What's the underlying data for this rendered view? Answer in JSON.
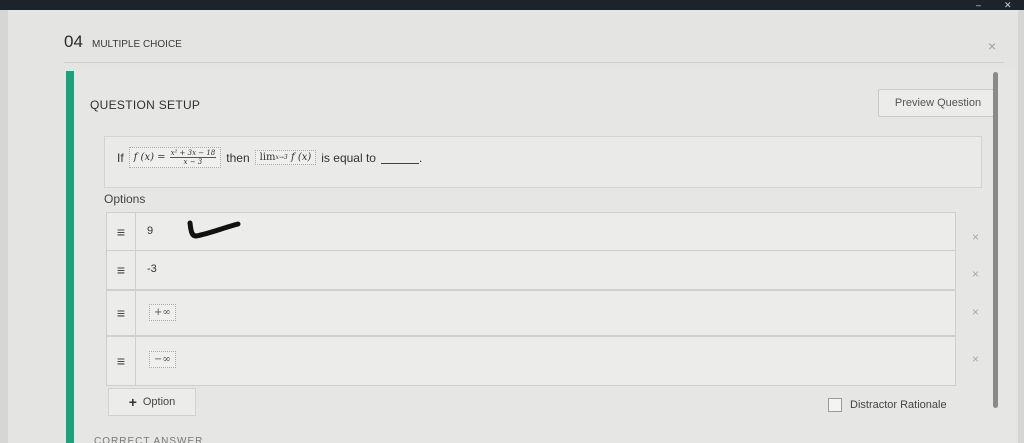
{
  "window": {
    "minimize_glyph": "–",
    "close_glyph": "✕"
  },
  "header": {
    "number": "04",
    "type": "MULTIPLE CHOICE",
    "close_glyph": "×"
  },
  "setup": {
    "title": "QUESTION SETUP",
    "preview_label": "Preview Question"
  },
  "question": {
    "prefix": "If",
    "fn": "f (x) =",
    "fraction": {
      "numerator": "x² + 3x − 18",
      "denominator": "x − 3"
    },
    "then": "then",
    "limit_main": "lim",
    "limit_sub": "x→3",
    "limit_fn": "f (x)",
    "suffix": "is equal to",
    "end": "."
  },
  "options": {
    "label": "Options",
    "handle_glyph": "≡",
    "delete_glyph": "×",
    "items": [
      {
        "value": "9"
      },
      {
        "value": "-3"
      },
      {
        "value": "+∞"
      },
      {
        "value": "−∞"
      }
    ]
  },
  "add_option": {
    "plus": "+",
    "label": "Option"
  },
  "distractor": {
    "label": "Distractor Rationale",
    "checked": false
  },
  "next_section": {
    "label": "CORRECT ANSWER SETUP"
  }
}
